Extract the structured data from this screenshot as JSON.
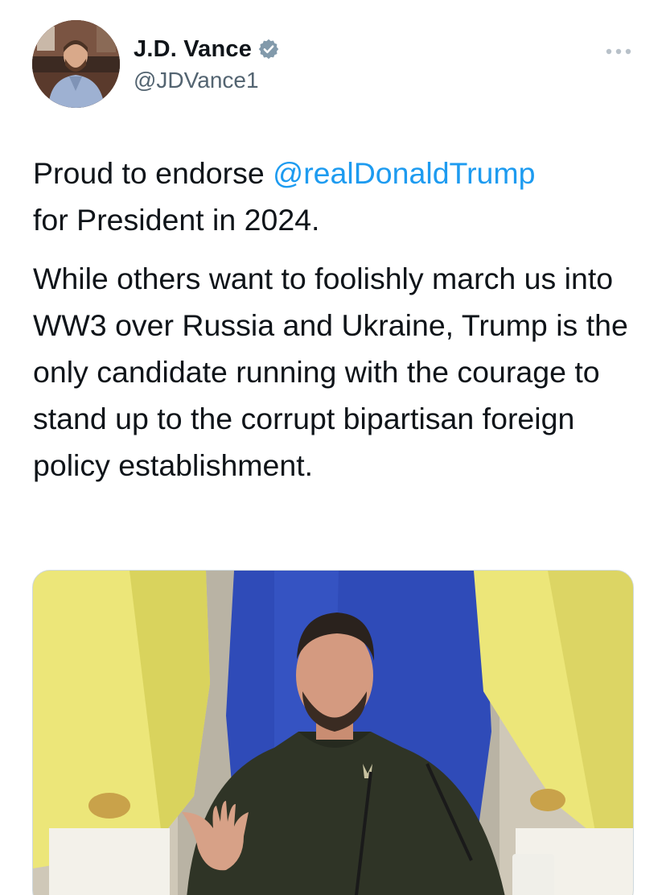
{
  "author": {
    "display_name": "J.D. Vance",
    "handle": "@JDVance1",
    "verified": true,
    "avatar_icon": "profile-photo"
  },
  "tweet": {
    "paragraph1": {
      "prefix": "Proud to endorse ",
      "mention": "@realDonaldTrump",
      "line2": "for President in 2024."
    },
    "paragraph2": "While others want to foolishly march us into WW3 over Russia and Ukraine, Trump is the only candidate running with the courage to stand up to the corrupt bipartisan foreign policy establishment."
  },
  "media": {
    "kind": "photo"
  },
  "icons": {
    "more": "more-options-icon",
    "verified": "verified-badge-icon"
  },
  "colors": {
    "link": "#1d9bf0",
    "text": "#0f1419",
    "secondary": "#536471",
    "verified": "#829aab"
  }
}
